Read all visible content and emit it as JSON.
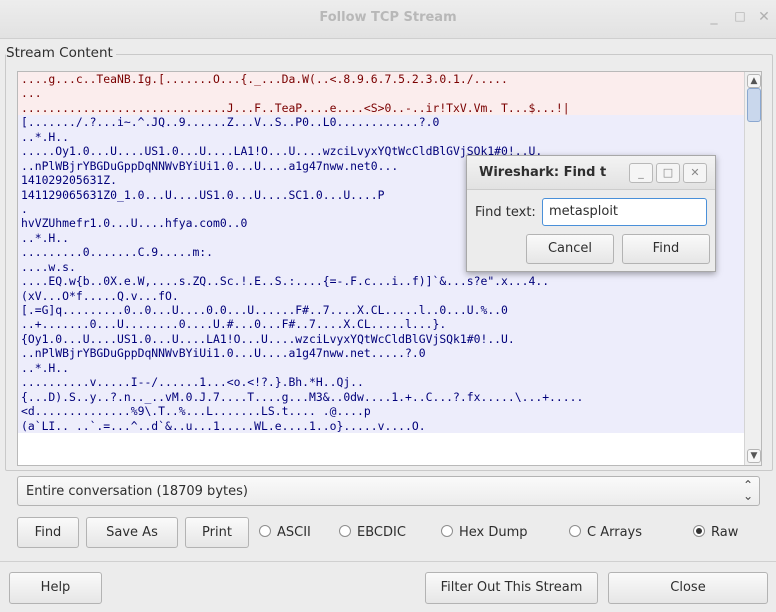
{
  "window": {
    "title": "Follow TCP Stream",
    "minimize": "_",
    "maximize": "□",
    "close": "✕"
  },
  "stream": {
    "legend": "Stream Content",
    "lines": [
      {
        "dir": "client",
        "text": "....g...c..TeaNB.Ig.[.......O...{._...Da.W(..<.8.9.6.7.5.2.3.0.1./....."
      },
      {
        "dir": "client",
        "text": "..."
      },
      {
        "dir": "client",
        "text": "..............................J...F..TeaP....e....<S>0..-..ir!TxV.Vm. T...$...!|"
      },
      {
        "dir": "server",
        "text": "[......./.?...i~.^.JQ..9......Z...V..S..P0..L0............?.0"
      },
      {
        "dir": "server",
        "text": "..*.H.."
      },
      {
        "dir": "server",
        "text": ".....Oy1.0...U....US1.0...U....LA1!O...U....wzciLvyxYQtWcCldBlGVjSQk1#0!..U."
      },
      {
        "dir": "server",
        "text": "..nPlWBjrYBGDuGppDqNNWvBYiUi1.0...U....a1g47nww.net0..."
      },
      {
        "dir": "server",
        "text": "141029205631Z."
      },
      {
        "dir": "server",
        "text": "141129065631Z0_1.0...U....US1.0...U....SC1.0...U....P"
      },
      {
        "dir": "server",
        "text": "."
      },
      {
        "dir": "server",
        "text": "hvVZUhmefr1.0...U....hfya.com0..0"
      },
      {
        "dir": "server",
        "text": "..*.H.."
      },
      {
        "dir": "server",
        "text": ".........0.......C.9.....m:."
      },
      {
        "dir": "server",
        "text": "....w.s."
      },
      {
        "dir": "server",
        "text": "....EQ.w{b..0X.e.W,....s.ZQ..Sc.!.E..S.:....{=-.F.c...i..f)]`&...s?e\".x...4.."
      },
      {
        "dir": "server",
        "text": "(xV...O*f.....Q.v...fO."
      },
      {
        "dir": "server",
        "text": "[.=G]q.........0..0...U....0.0...U......F#..7....X.CL.....l..0...U.%..0"
      },
      {
        "dir": "server",
        "text": "..+.......0...U........0....U.#...0...F#..7....X.CL.....l...}."
      },
      {
        "dir": "server",
        "text": "{Oy1.0...U....US1.0...U....LA1!O...U....wzciLvyxYQtWcCldBlGVjSQk1#0!..U."
      },
      {
        "dir": "server",
        "text": "..nPlWBjrYBGDuGppDqNNWvBYiUi1.0...U....a1g47nww.net.....?.0"
      },
      {
        "dir": "server",
        "text": "..*.H.."
      },
      {
        "dir": "server",
        "text": "..........v.....I--/......1...<o.<!?.}.Bh.*H..Qj.."
      },
      {
        "dir": "server",
        "text": "{...D).S..y..?.n.._..vM.0.J.7....T....g...M3&..0dw....1.+..C...?.fx.....\\...+....."
      },
      {
        "dir": "server",
        "text": "<d..............%9\\.T..%...L.......LS.t.... .@....p"
      },
      {
        "dir": "server",
        "text": "(a`LI.. ..`.=...^..d`&..u...1.....WL.e....1..o}.....v....O."
      }
    ]
  },
  "conversation_select": {
    "value": "Entire conversation (18709 bytes)"
  },
  "buttons": {
    "find": "Find",
    "save_as": "Save As",
    "print": "Print",
    "help": "Help",
    "filter_out": "Filter Out This Stream",
    "close": "Close"
  },
  "formats": [
    {
      "label": "ASCII",
      "selected": false
    },
    {
      "label": "EBCDIC",
      "selected": false
    },
    {
      "label": "Hex Dump",
      "selected": false
    },
    {
      "label": "C Arrays",
      "selected": false
    },
    {
      "label": "Raw",
      "selected": true
    }
  ],
  "find_dialog": {
    "title": "Wireshark: Find t",
    "label": "Find text:",
    "value": "metasploit",
    "cancel": "Cancel",
    "find": "Find",
    "minimize": "_",
    "maximize": "□",
    "close": "✕"
  }
}
